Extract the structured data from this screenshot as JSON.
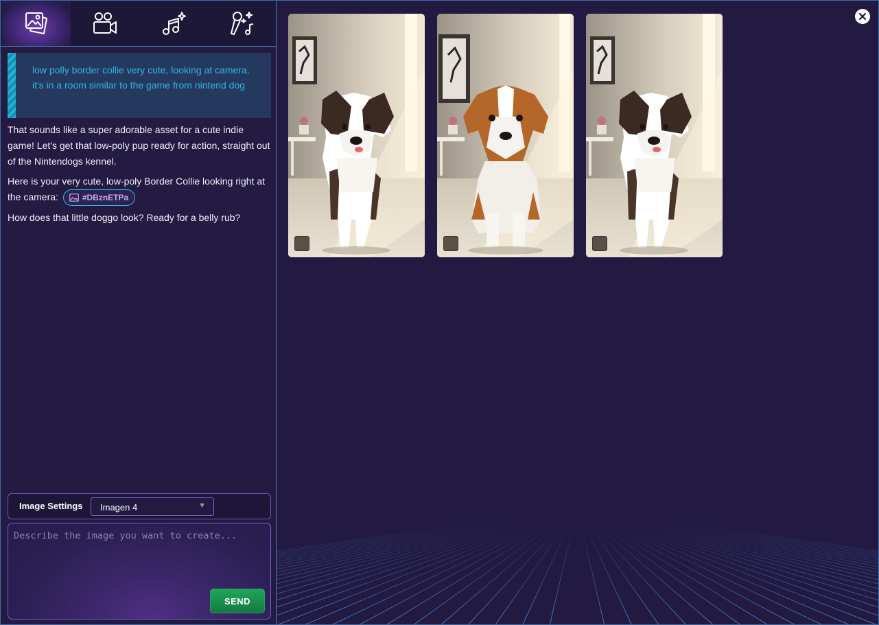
{
  "tabs": [
    {
      "name": "image-tab",
      "icon": "image-gallery-icon",
      "active": true
    },
    {
      "name": "video-tab",
      "icon": "video-camera-icon",
      "active": false
    },
    {
      "name": "music-tab",
      "icon": "music-sparkle-icon",
      "active": false
    },
    {
      "name": "voice-tab",
      "icon": "microphone-sparkle-icon",
      "active": false
    }
  ],
  "chat": {
    "user_prompt": "low polly border collie very cute, looking at camera. it's in a room similar to the game from nintend dog",
    "ai_paragraph_1": "That sounds like a super adorable asset for a cute indie game! Let's get that low-poly pup ready for action, straight out of the Nintendogs kennel.",
    "ai_paragraph_2_prefix": "Here is your very cute, low-poly Border Collie looking right at the camera:",
    "image_ref_tag": "#DBznETPa",
    "ai_paragraph_3": "How does that little doggo look? Ready for a belly rub?"
  },
  "settings": {
    "label": "Image Settings",
    "model_value": "Imagen 4"
  },
  "prompt": {
    "placeholder": "Describe the image you want to create...",
    "send_label": "SEND"
  },
  "gallery": {
    "images": [
      {
        "subject": "black-white border collie",
        "fur": "#2a1d18",
        "selected": false
      },
      {
        "subject": "orange-white puppy",
        "fur": "#b5672a",
        "selected": false
      },
      {
        "subject": "black-white border collie",
        "fur": "#2a1d18",
        "selected": false
      }
    ]
  },
  "colors": {
    "background": "#221a40",
    "accent_cyan": "#2fb6e0",
    "accent_purple": "#7a5fcf",
    "send_green": "#1fa65a"
  }
}
